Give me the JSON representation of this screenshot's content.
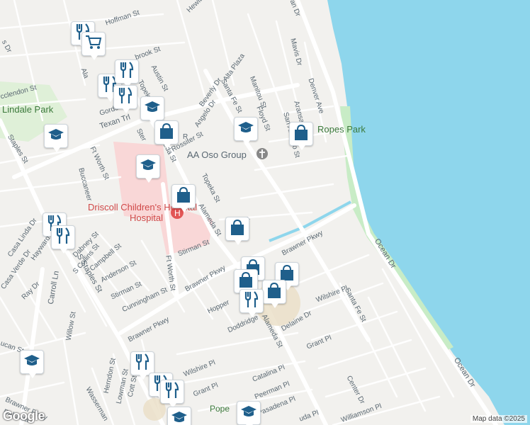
{
  "map": {
    "attribution": "Map data ©2025",
    "logo": "Google",
    "colors": {
      "water": "#8ed6ec",
      "land": "#f2f1ee",
      "park": "#c8ecc6",
      "road": "#ffffff",
      "major_road": "#ffffff",
      "hospital": "#f9d7d7",
      "label": "#5a6872",
      "poi": "#1f5f8b"
    },
    "places": {
      "ropes_park": "Ropes Park",
      "lindale_park": "Lindale Park",
      "aa_oso_group": "AA Oso Group",
      "hospital": "Driscoll Children's Hospital",
      "hospital_line2": "Hospital",
      "pope": "Pope"
    },
    "streets": {
      "s_hoffman": "Hoffman St",
      "s_hewit": "Hewit",
      "s_mavis": "Mavis Dr",
      "s_denver": "Denver Ave",
      "s_aransas": "Aransas",
      "s_san_antonio": "San Antonio St",
      "s_floyd": "Floyd St",
      "s_manitou": "Manitou St",
      "s_alta": "Alta Plaza",
      "s_beverly": "Beverly Dr",
      "s_angelo": "Angelo Dr",
      "s_santa_fe": "Santa Fe St",
      "s_austin": "Austin St",
      "s_topeka": "Topeka St",
      "s_topeka2": "Topeka St",
      "s_rossiter": "Rossiter St",
      "s_texan": "Texan Trl",
      "s_alameda": "Alameda St",
      "s_alameda2": "Alameda St",
      "s_alameda3": "Alameda St",
      "s_gordon": "Gordon",
      "s_mcclendon": "cclendon St",
      "s_staples": "Staples St",
      "s_staples2": "S Staples St",
      "s_ftworth": "Ft Worth St",
      "s_ftworth2": "Ft Worth St",
      "s_buccaneer": "Buccaneer",
      "s_casa_linda": "Casa Linda Dr",
      "s_casa_verde": "Casa Verde Dr",
      "s_hayward": "Hayward",
      "s_dabney": "Dabney St",
      "s_collins": "S Collins St",
      "s_campbell": "Campbell St",
      "s_anderson": "Anderson St",
      "s_stirman": "Stirman St",
      "s_stirman2": "Stirman St",
      "s_cunningham": "Cunningham St",
      "s_brawner": "Brawner Pkwy",
      "s_brawner2": "Brawner Pkwy",
      "s_brawner3": "Brawner Pkwy",
      "s_brawner4": "Brawner Pkwy",
      "s_hopper": "Hopper",
      "s_doddridge": "Doddridge",
      "s_delaine": "Delaine Dr",
      "s_wilshire": "Wilshire Pl",
      "s_wilshire2": "Wilshire Pl",
      "s_santa_fe2": "Santa Fe St",
      "s_ocean": "Ocean Dr",
      "s_ocean2": "Ocean Dr",
      "s_carroll": "Carroll Ln",
      "s_ray": "Ray Dr",
      "s_willow": "Willow St",
      "s_herndon": "Herndon St",
      "s_lowman": "Lowman St",
      "s_cott": "Cott St",
      "s_grant": "Grant Pl",
      "s_grant2": "Grant Pl",
      "s_catalina": "Catalina Pl",
      "s_peerman": "Peerman Pl",
      "s_pasadena": "Pasadena Pl",
      "s_center": "Center Dr",
      "s_williamson": "Williamson Pl",
      "s_wasserman": "Wasserman",
      "s_dalraida": "Dalraida",
      "s_ucan": "ucan St",
      "s_brook": "brook St",
      "s_pa": "Pa",
      "s_edn": "an Dr",
      "s_us_dr": "s Dr",
      "s_la": "Ala",
      "s_uda": "uda Pl",
      "s_ster": "Ster",
      "s_r": "R"
    },
    "pins": [
      {
        "icon": "restaurant-icon"
      },
      {
        "icon": "shopping-cart-icon"
      },
      {
        "icon": "restaurant-icon"
      },
      {
        "icon": "restaurant-icon"
      },
      {
        "icon": "restaurant-icon"
      },
      {
        "icon": "school-icon"
      },
      {
        "icon": "shopping-bag-icon"
      },
      {
        "icon": "school-icon"
      },
      {
        "icon": "school-icon"
      },
      {
        "icon": "shopping-bag-icon"
      },
      {
        "icon": "school-icon"
      },
      {
        "icon": "shopping-bag-icon"
      },
      {
        "icon": "shopping-bag-icon"
      },
      {
        "icon": "restaurant-icon"
      },
      {
        "icon": "shopping-bag-icon"
      },
      {
        "icon": "shopping-bag-icon"
      },
      {
        "icon": "shopping-bag-icon"
      },
      {
        "icon": "shopping-bag-icon"
      },
      {
        "icon": "restaurant-icon"
      },
      {
        "icon": "school-icon"
      },
      {
        "icon": "restaurant-icon"
      },
      {
        "icon": "restaurant-icon"
      },
      {
        "icon": "restaurant-icon"
      },
      {
        "icon": "school-icon"
      },
      {
        "icon": "school-icon"
      },
      {
        "icon": "restaurant-icon"
      }
    ]
  }
}
